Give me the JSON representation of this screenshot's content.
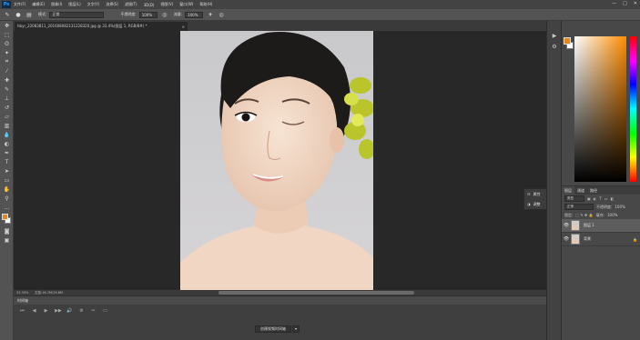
{
  "app": {
    "logo": "Ps"
  },
  "menu": [
    "文件(F)",
    "编辑(E)",
    "图像(I)",
    "图层(L)",
    "文字(Y)",
    "选择(S)",
    "滤镜(T)",
    "3D(D)",
    "视图(V)",
    "窗口(W)",
    "帮助(H)"
  ],
  "window_buttons": [
    "—",
    "□",
    "✕"
  ],
  "options": {
    "mode_label": "模式:",
    "mode_value": "正常",
    "opacity_label": "不透明度:",
    "opacity_value": "100%",
    "flow_label": "流量:",
    "flow_value": "100%"
  },
  "document": {
    "tab_title": "hbyr_22083811_201608082131228320.jpg @ 33.4%(图层 1, RGB/8#) *",
    "close": "×"
  },
  "status": {
    "zoom": "33.33%",
    "doc_info": "文档:16.7M/16.8M"
  },
  "timeline": {
    "title": "时间轴",
    "create_button": "创建视频时间轴",
    "controls": [
      "⏮",
      "◀",
      "▶",
      "▶▶",
      "🔊",
      "⚙",
      "✂",
      "▭"
    ]
  },
  "properties": {
    "items": [
      {
        "label": "属性"
      },
      {
        "label": "调整"
      }
    ]
  },
  "layers": {
    "tabs": [
      "图层",
      "通道",
      "路径"
    ],
    "filter_label": "类型",
    "blend_mode": "正常",
    "opacity_label": "不透明度:",
    "opacity_value": "100%",
    "lock_label": "锁定:",
    "fill_label": "填充:",
    "fill_value": "100%",
    "items": [
      {
        "name": "图层 1",
        "selected": true
      },
      {
        "name": "背景",
        "selected": false
      }
    ]
  },
  "colors": {
    "foreground": "#e08a1a",
    "background": "#ffffff",
    "ui_dark": "#282828",
    "ui_panel": "#535353"
  }
}
